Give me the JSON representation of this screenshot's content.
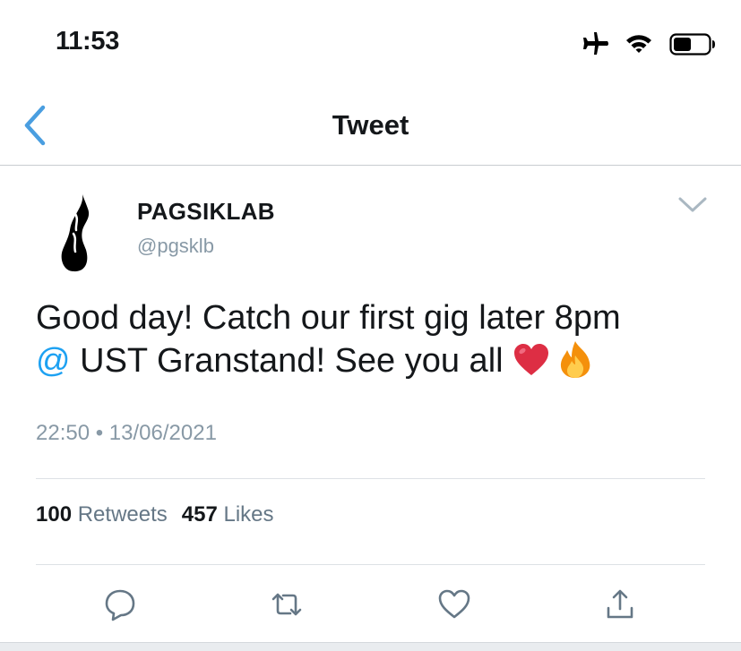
{
  "status_bar": {
    "time": "11:53",
    "icons": [
      "airplane-mode-icon",
      "wifi-icon",
      "battery-icon"
    ]
  },
  "nav": {
    "title": "Tweet",
    "back_icon": "chevron-left-icon"
  },
  "tweet": {
    "author": {
      "display_name": "PAGSIKLAB",
      "handle": "@pgsklb",
      "avatar_icon": "flame-logo"
    },
    "text_line_1": "Good day! Catch our first gig later 8pm",
    "text_line_2_at": "@",
    "text_line_2_rest": " UST Granstand! See you all",
    "emojis": [
      "heart",
      "fire"
    ],
    "timestamp": "22:50 • 13/06/2021",
    "retweets_count": "100",
    "retweets_label": "Retweets",
    "likes_count": "457",
    "likes_label": "Likes"
  },
  "actions": [
    "reply-icon",
    "retweet-icon",
    "like-icon",
    "share-icon"
  ],
  "colors": {
    "accent": "#1da1f2",
    "back_chevron": "#4a9ee0",
    "secondary_text": "#8899a6",
    "heart": "#e0245e",
    "action_icons": "#657786"
  }
}
